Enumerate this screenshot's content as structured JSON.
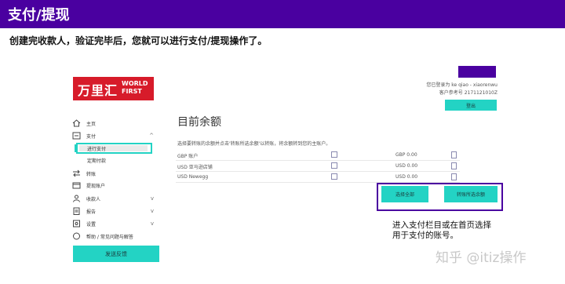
{
  "header": {
    "title": "支付/提现"
  },
  "subtitle": "创建完收款人，验证完毕后，您就可以进行支付/提现操作了。",
  "logo": {
    "cn": "万里汇",
    "en1": "WORLD",
    "en2": "FIRST"
  },
  "account": {
    "logged_in_as": "您已登录为 ke qiao - xiaorenwu",
    "customer_ref": "客户参考号 2171121010Z",
    "logout_label": "登出"
  },
  "sidebar": {
    "items": [
      {
        "label": "主页",
        "icon": "home-icon"
      },
      {
        "label": "支付",
        "icon": "payment-icon",
        "chevron": "^"
      },
      {
        "label": "转账",
        "icon": "transfer-icon"
      },
      {
        "label": "提现账户",
        "icon": "account-icon"
      },
      {
        "label": "收款人",
        "icon": "recipient-icon",
        "chevron": "v"
      },
      {
        "label": "报告",
        "icon": "report-icon",
        "chevron": "v"
      },
      {
        "label": "设置",
        "icon": "settings-icon",
        "chevron": "v"
      },
      {
        "label": "帮助 / 常见问题与解答",
        "icon": "help-icon"
      }
    ],
    "sub_items": [
      "进行支付",
      "定期付款"
    ],
    "feedback_label": "发送反馈"
  },
  "main": {
    "title": "目前余额",
    "description": "选择要转账的余额并点击'转账所选余额'以转账，将余额转到您的主账户。",
    "rows": [
      {
        "name": "GBP 账户",
        "balance": "GBP 0.00"
      },
      {
        "name": "USD 亚马逊店铺",
        "balance": "USD 0.00"
      },
      {
        "name": "USD Newegg",
        "balance": "USD 0.00"
      }
    ],
    "select_all_label": "选择全部",
    "transfer_selected_label": "转账所选余额"
  },
  "note": {
    "line1": "进入支付栏目或在首页选择",
    "line2": "用于支付的账号。"
  },
  "watermark": "知乎 @itiz操作",
  "colors": {
    "brand": "#4a00a0",
    "accent": "#23d3c4",
    "logo_red": "#d71b2a"
  }
}
